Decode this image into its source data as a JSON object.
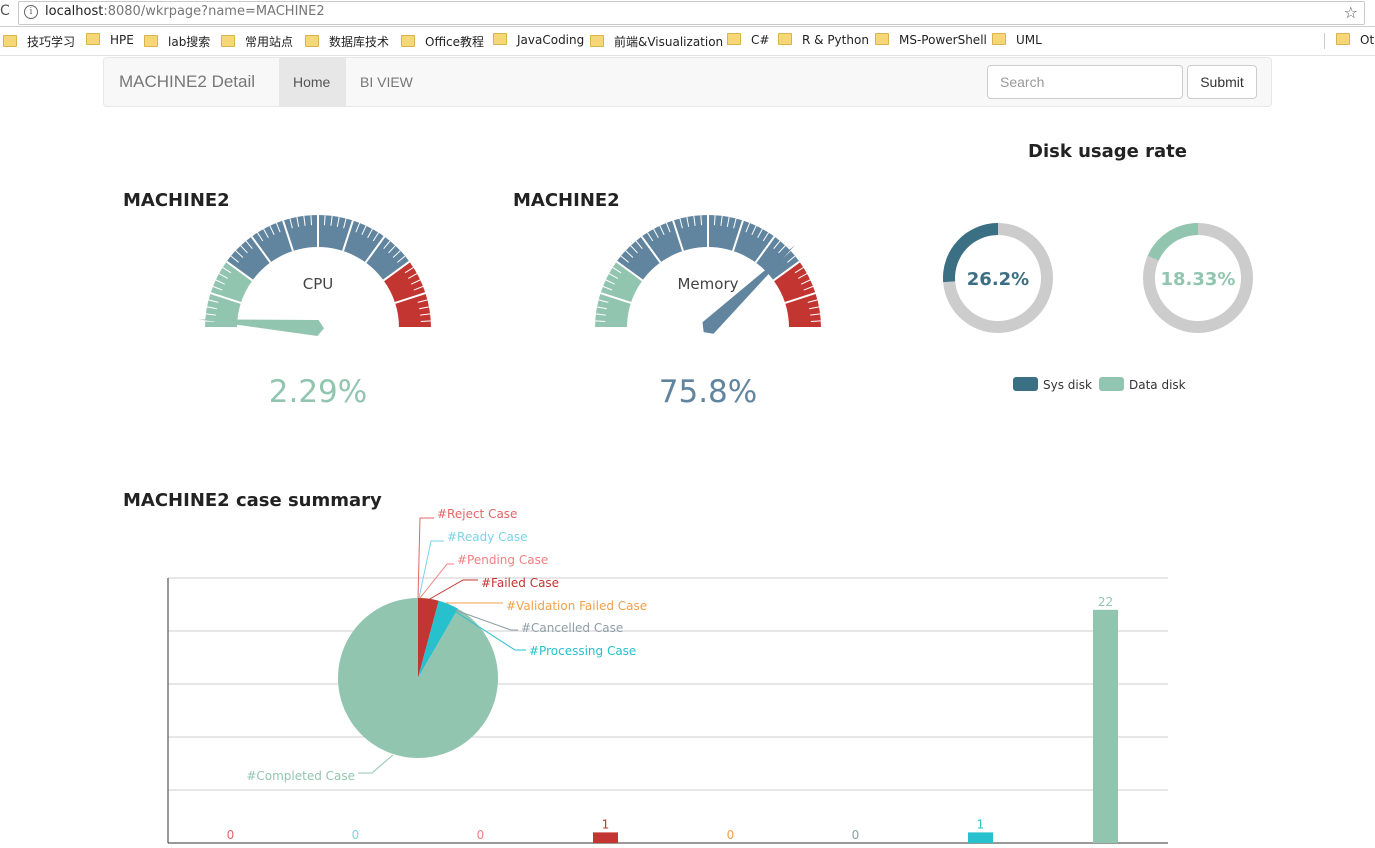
{
  "browser": {
    "url_host": "localhost",
    "url_rest": ":8080/wkrpage?name=MACHINE2",
    "bookmarks": [
      "技巧学习",
      "HPE",
      "lab搜索",
      "常用站点",
      "数据库技术",
      "Office教程",
      "JavaCoding",
      "前端&Visualization",
      "C#",
      "R & Python",
      "MS-PowerShell",
      "UML",
      "Oth"
    ]
  },
  "navbar": {
    "brand": "MACHINE2 Detail",
    "home": "Home",
    "bi_view": "BI VIEW",
    "search_placeholder": "Search",
    "submit": "Submit"
  },
  "cpu": {
    "machine": "MACHINE2",
    "label": "CPU",
    "value_text": "2.29%",
    "value": 2.29,
    "color": "#92c5af"
  },
  "memory": {
    "machine": "MACHINE2",
    "label": "Memory",
    "value_text": "75.8%",
    "value": 75.8,
    "color": "#61849f"
  },
  "disk": {
    "title": "Disk usage rate",
    "sys": {
      "value_text": "26.2%",
      "value": 26.2,
      "label": "Sys disk",
      "color": "#3a6f84"
    },
    "data": {
      "value_text": "18.33%",
      "value": 18.33,
      "label": "Data disk",
      "color": "#92c5af"
    }
  },
  "summary": {
    "title": "MACHINE2 case summary"
  },
  "chart_data": {
    "type": "bar",
    "categories": [
      "#Reject Case",
      "#Ready Case",
      "#Pending Case",
      "#Failed Case",
      "#Validation Failed Case",
      "#Cancelled Case",
      "#Processing Case",
      "#Completed Case"
    ],
    "values": [
      0,
      0,
      0,
      1,
      0,
      0,
      1,
      22
    ],
    "labels": [
      "0",
      "0",
      "0",
      "1",
      "0",
      "0",
      "1",
      "22"
    ],
    "colors": [
      "#e06666",
      "#7bd3e8",
      "#f08080",
      "#c23531",
      "#f0a04b",
      "#8e9ea6",
      "#27c0cd",
      "#92c5af"
    ],
    "ylim": [
      0,
      25
    ],
    "grid": true,
    "pie": {
      "type": "pie",
      "labels": [
        "#Reject Case",
        "#Ready Case",
        "#Pending Case",
        "#Failed Case",
        "#Validation Failed Case",
        "#Cancelled Case",
        "#Processing Case",
        "#Completed Case"
      ],
      "values": [
        0,
        0,
        0,
        1,
        0,
        0,
        1,
        22
      ]
    }
  }
}
